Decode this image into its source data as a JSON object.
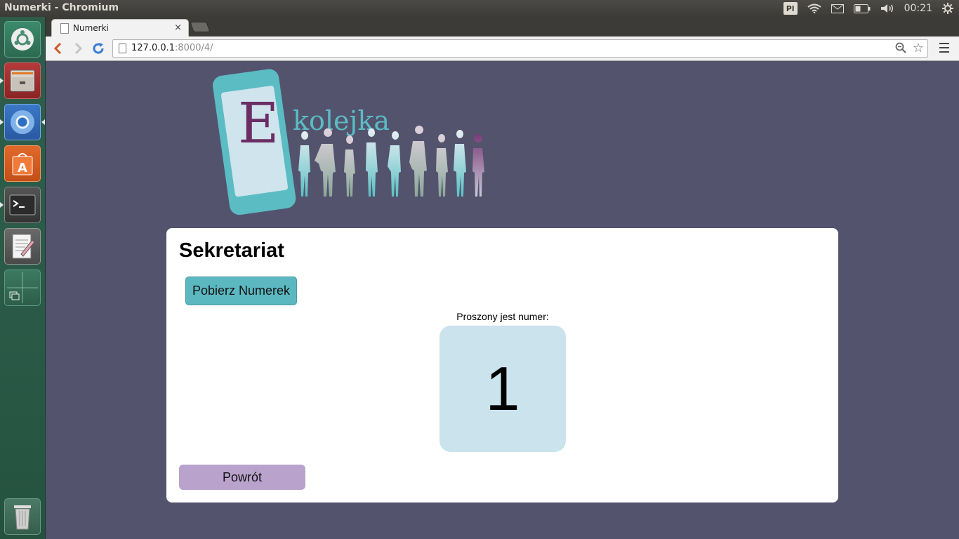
{
  "window": {
    "title": "Numerki - Chromium"
  },
  "tray": {
    "keyboard_layout": "Pl",
    "clock": "00:21"
  },
  "browser": {
    "tab": {
      "label": "Numerki",
      "close": "×"
    },
    "address": {
      "host": "127.0.0.1",
      "path": ":8000/4/"
    }
  },
  "page": {
    "logo": {
      "letter": "E",
      "word": "kolejka"
    },
    "heading": "Sekretariat",
    "get_number_button": "Pobierz Numerek",
    "called_label": "Proszony jest numer:",
    "current_number": "1",
    "back_button": "Powrót"
  },
  "colors": {
    "page_bg": "#53536d",
    "teal": "#5bb8c1",
    "number_box": "#cae3ec",
    "back_button": "#b9a3cd",
    "logo_purple": "#6b2d64"
  }
}
